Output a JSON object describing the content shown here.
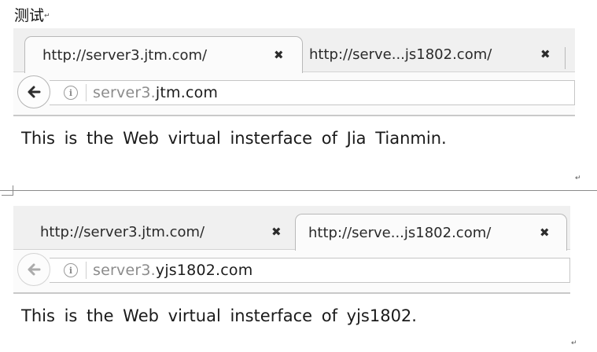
{
  "document": {
    "heading": "测试",
    "para_mark": "↵"
  },
  "screenshots": [
    {
      "tabs": [
        {
          "title": "http://server3.jtm.com/",
          "close": "✖",
          "active": true
        },
        {
          "title": "http://serve...js1802.com/",
          "close": "✖",
          "active": false
        }
      ],
      "url_dim": "server3.",
      "url_main": "jtm.com",
      "back_enabled": true,
      "page_text": "This is the Web virtual insterface of Jia Tianmin."
    },
    {
      "tabs": [
        {
          "title": "http://server3.jtm.com/",
          "close": "✖",
          "active": false
        },
        {
          "title": "http://serve...js1802.com/",
          "close": "✖",
          "active": true
        }
      ],
      "url_dim": "server3.",
      "url_main": "yjs1802.com",
      "back_enabled": false,
      "page_text": "This is the Web virtual insterface of yjs1802."
    }
  ],
  "icons": {
    "back": "back-arrow-icon",
    "info": "info-icon",
    "close": "close-icon"
  }
}
